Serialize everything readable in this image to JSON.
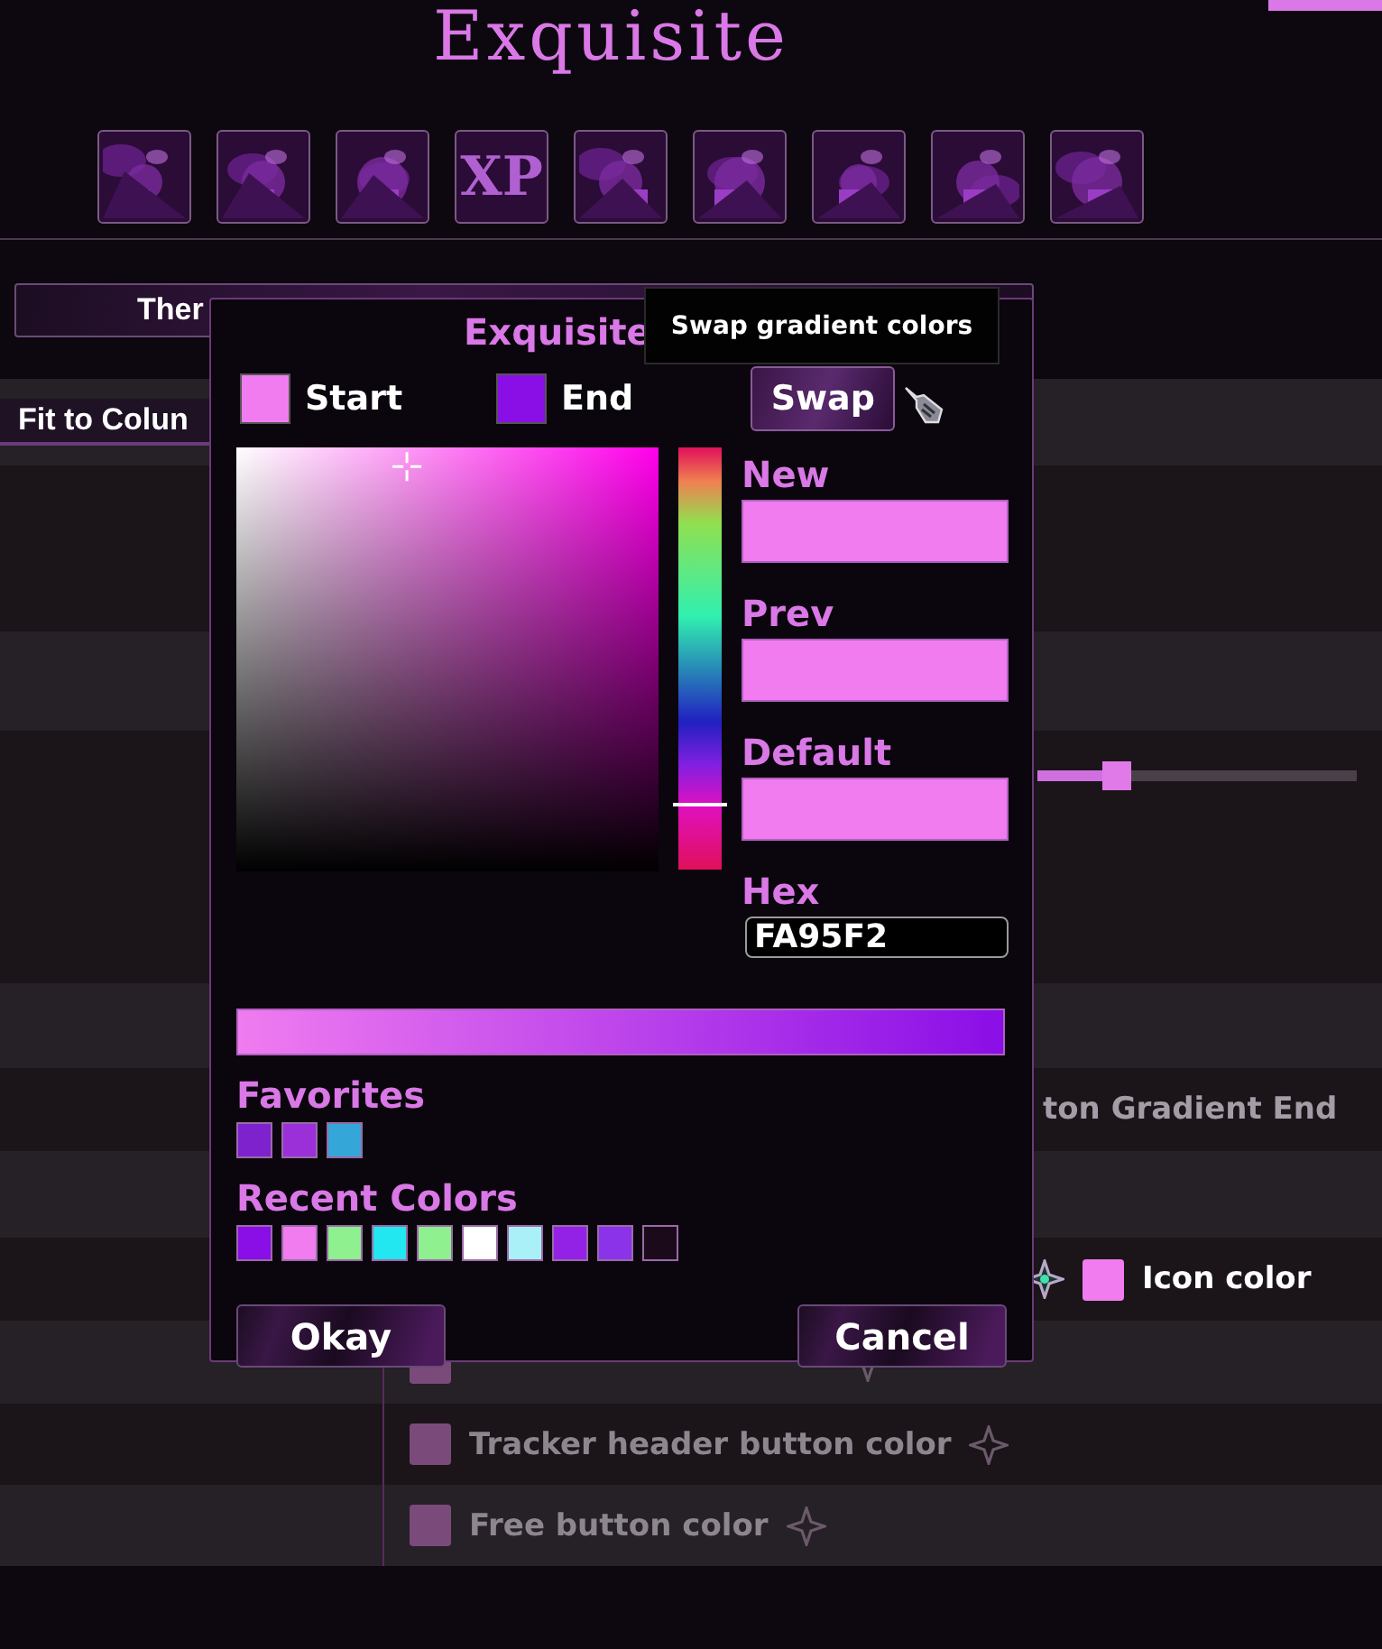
{
  "logo": "Exquisite",
  "category_tabs": [
    {
      "kind": "picture"
    },
    {
      "kind": "picture"
    },
    {
      "kind": "picture"
    },
    {
      "kind": "text",
      "label": "XP"
    },
    {
      "kind": "picture"
    },
    {
      "kind": "picture"
    },
    {
      "kind": "picture"
    },
    {
      "kind": "picture"
    },
    {
      "kind": "picture"
    }
  ],
  "theme_button": "Ther",
  "fit_button": "Fit to Colun",
  "slider": {
    "level": 0.25
  },
  "gradient_end_label": "ton Gradient End",
  "settings": [
    {
      "label": "Icon color",
      "color": "#f07cf0",
      "disabled": false
    },
    {
      "color": "#7a4a7a",
      "disabled": true
    },
    {
      "label": "Tracker header button color",
      "color": "#7a4a7a",
      "disabled": true
    },
    {
      "label": "Free button color",
      "color": "#7a4a7a",
      "disabled": true
    }
  ],
  "picker": {
    "title": "Exquisite",
    "start": {
      "label": "Start",
      "color": "#f07cf0"
    },
    "end": {
      "label": "End",
      "color": "#8a0ee6"
    },
    "swap_button": "Swap",
    "tooltip": "Swap gradient colors",
    "previews": [
      {
        "label": "New",
        "color": "#f07cf0"
      },
      {
        "label": "Prev",
        "color": "#f07cf0"
      },
      {
        "label": "Default",
        "color": "#f07cf0"
      }
    ],
    "hex_label": "Hex",
    "hex_value": "FA95F2",
    "favorites_label": "Favorites",
    "favorites": [
      {
        "color": "#7e22ce"
      },
      {
        "color": "#9b30d9"
      },
      {
        "color": "#35a6d8"
      }
    ],
    "recent_label": "Recent Colors",
    "recent": [
      {
        "color": "#8a0ee6"
      },
      {
        "color": "#f07cf0"
      },
      {
        "color": "#8ef08e"
      },
      {
        "color": "#22e6f0"
      },
      {
        "color": "#8ef08e"
      },
      {
        "color": "#ffffff"
      },
      {
        "color": "#aaf0f8"
      },
      {
        "color": "#9422e6"
      },
      {
        "color": "#8a33e8"
      },
      {
        "color": "#1a0a1a"
      }
    ],
    "buttons": [
      {
        "label": "Okay"
      },
      {
        "label": "Cancel"
      }
    ]
  }
}
